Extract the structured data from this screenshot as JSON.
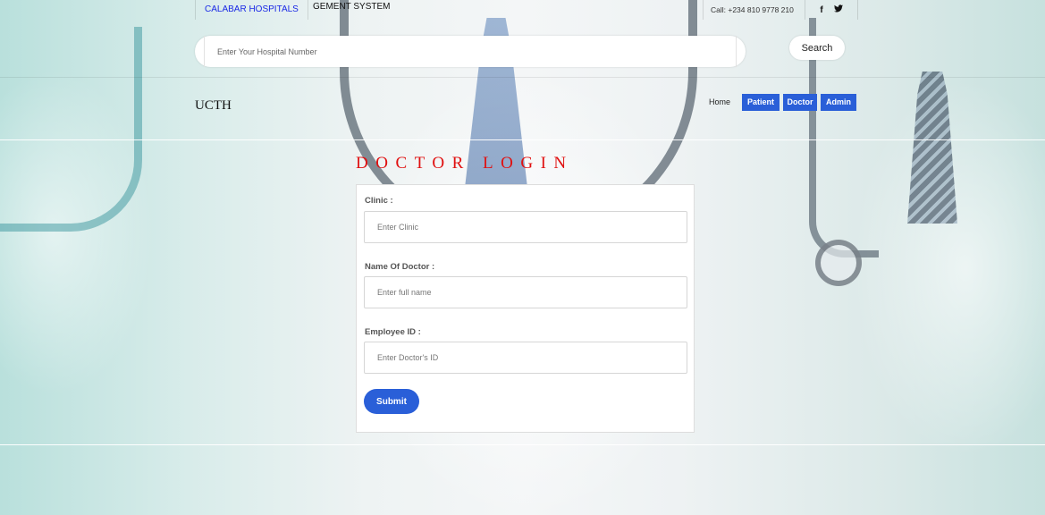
{
  "header": {
    "brand_link": "CALABAR HOSPITALS",
    "brand_tail": "GEMENT SYSTEM",
    "call": "Call: +234 810 9778 210",
    "social": {
      "facebook": "f",
      "twitter": "t"
    }
  },
  "search": {
    "placeholder": "Enter Your Hospital Number",
    "button_label": "Search"
  },
  "logo": "UCTH",
  "nav": {
    "home": "Home",
    "patient": "Patient",
    "doctor": "Doctor",
    "admin": "Admin"
  },
  "page_title": "DOCTOR LOGIN",
  "form": {
    "clinic_label": "Clinic :",
    "clinic_placeholder": "Enter Clinic",
    "name_label": "Name Of Doctor :",
    "name_placeholder": "Enter full name",
    "employee_label": "Employee ID :",
    "employee_placeholder": "Enter Doctor's ID",
    "submit_label": "Submit"
  },
  "colors": {
    "accent": "#2a5fd8",
    "title": "#e01010",
    "brand_link": "#1a28e6"
  }
}
